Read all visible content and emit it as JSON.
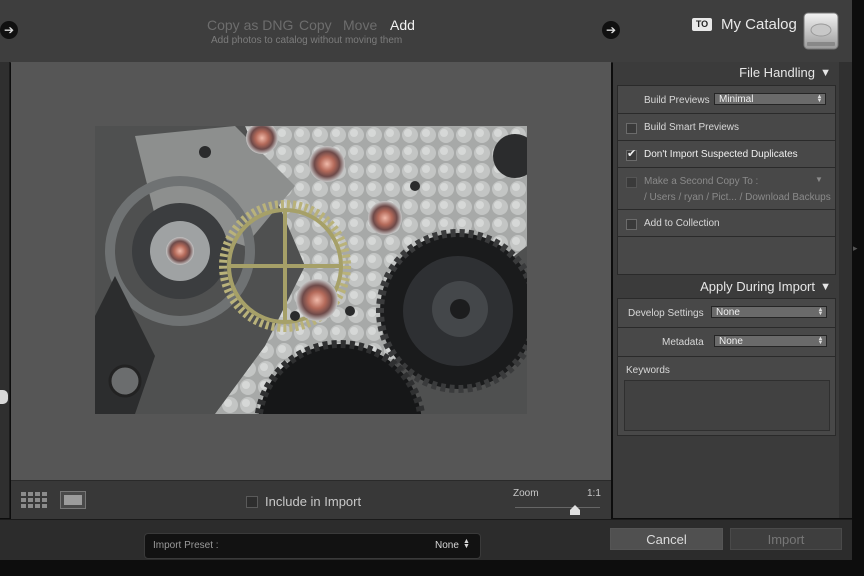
{
  "topbar": {
    "modes": [
      {
        "label": "Copy as DNG",
        "active": false
      },
      {
        "label": "Copy",
        "active": false
      },
      {
        "label": "Move",
        "active": false
      },
      {
        "label": "Add",
        "active": true
      }
    ],
    "mode_description": "Add photos to catalog without moving them",
    "to_badge": "TO",
    "catalog_name": "My Catalog",
    "icons": [
      "arrow-right-icon",
      "arrow-right-icon",
      "hard-disk-icon"
    ]
  },
  "file_handling": {
    "header": "File Handling",
    "build_previews_label": "Build Previews",
    "build_previews_value": "Minimal",
    "smart_previews_label": "Build Smart Previews",
    "smart_previews_checked": false,
    "dont_import_label": "Don't Import Suspected Duplicates",
    "dont_import_checked": true,
    "second_copy_label": "Make a Second Copy To :",
    "second_copy_path": "/ Users / ryan / Pict... / Download Backups",
    "second_copy_checked": false,
    "add_collection_label": "Add to Collection",
    "add_collection_checked": false
  },
  "apply_during_import": {
    "header": "Apply During Import",
    "develop_label": "Develop Settings",
    "develop_value": "None",
    "metadata_label": "Metadata",
    "metadata_value": "None",
    "keywords_label": "Keywords",
    "keywords_value": ""
  },
  "preview_toolbar": {
    "include_label": "Include in Import",
    "zoom_label": "Zoom",
    "zoom_level": "1:1",
    "zoom_fraction": 0.7
  },
  "footer": {
    "import_preset_label": "Import Preset :",
    "import_preset_value": "None",
    "cancel_label": "Cancel",
    "import_label": "Import"
  },
  "colors": {
    "panel_bg": "#3b3b3b",
    "box_bg": "#484848",
    "center_bg": "#565656",
    "active_mode": "#f2f2f2",
    "inactive_mode": "#6d6d6d"
  }
}
